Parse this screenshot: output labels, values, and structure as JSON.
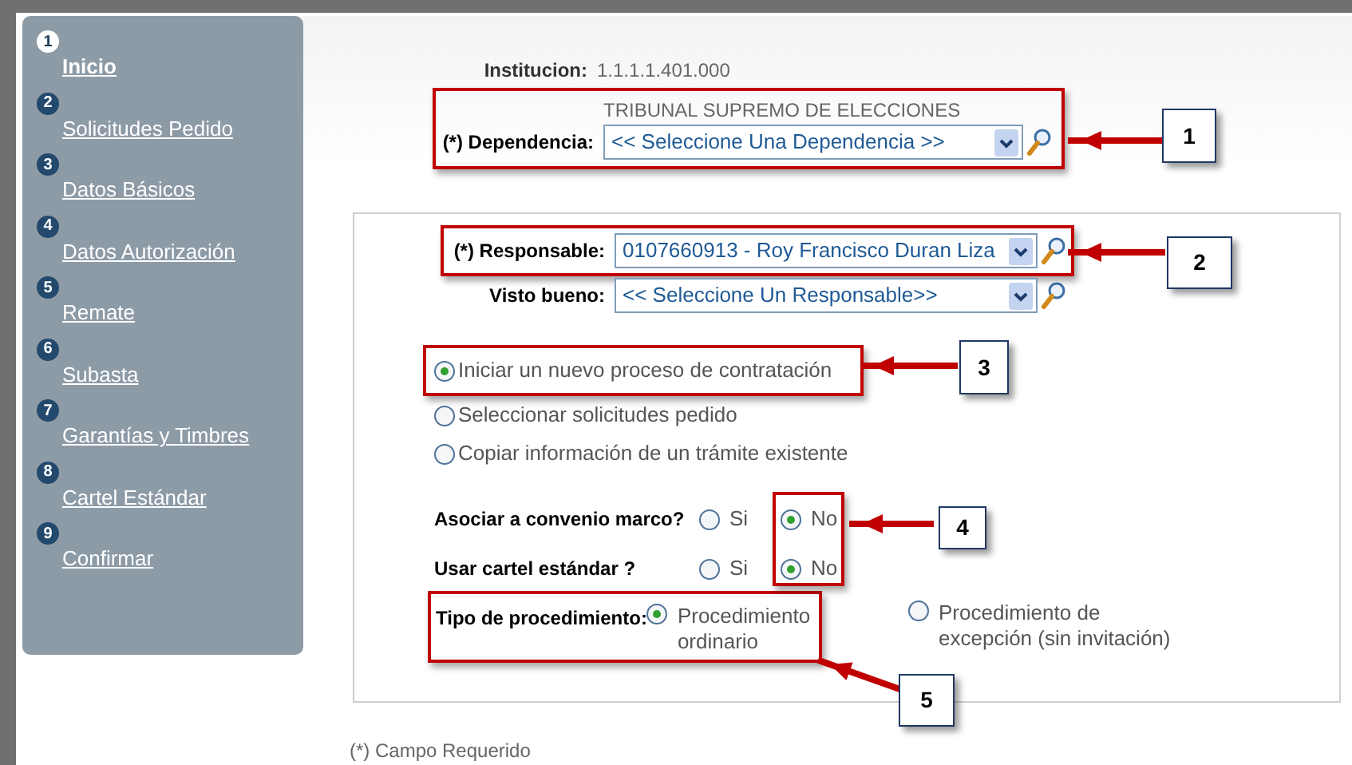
{
  "steps": [
    {
      "number": "1",
      "label": "Inicio",
      "selected": true
    },
    {
      "number": "2",
      "label": "Solicitudes Pedido",
      "selected": false
    },
    {
      "number": "3",
      "label": "Datos Básicos",
      "selected": false
    },
    {
      "number": "4",
      "label": "Datos Autorización",
      "selected": false
    },
    {
      "number": "5",
      "label": "Remate",
      "selected": false
    },
    {
      "number": "6",
      "label": "Subasta",
      "selected": false
    },
    {
      "number": "7",
      "label": "Garantías y Timbres",
      "selected": false
    },
    {
      "number": "8",
      "label": "Cartel Estándar",
      "selected": false
    },
    {
      "number": "9",
      "label": "Confirmar",
      "selected": false
    }
  ],
  "institucion": {
    "label": "Institucion:",
    "value": "1.1.1.1.401.000"
  },
  "dependencia": {
    "caption": "TRIBUNAL SUPREMO DE ELECCIONES",
    "label": "(*) Dependencia:",
    "value": "<< Seleccione Una Dependencia >>"
  },
  "responsable": {
    "label": "(*) Responsable:",
    "value": "0107660913 - Roy Francisco Duran Liza"
  },
  "visto_bueno": {
    "label": "Visto bueno:",
    "value": "<< Seleccione Un Responsable>>"
  },
  "process_options": [
    {
      "label": "Iniciar un nuevo proceso de contratación",
      "selected": true
    },
    {
      "label": "Seleccionar solicitudes pedido",
      "selected": false
    },
    {
      "label": "Copiar información de un trámite existente",
      "selected": false
    }
  ],
  "questions": [
    {
      "label": "Asociar a convenio marco?",
      "options": [
        {
          "label": "Si",
          "selected": false
        },
        {
          "label": "No",
          "selected": true
        }
      ]
    },
    {
      "label": "Usar cartel estándar ?",
      "options": [
        {
          "label": "Si",
          "selected": false
        },
        {
          "label": "No",
          "selected": true
        }
      ]
    }
  ],
  "tipo_procedimiento": {
    "label": "Tipo de procedimiento:",
    "options": [
      {
        "label": "Procedimiento ordinario",
        "selected": true
      },
      {
        "label": "Procedimiento de excepción (sin invitación)",
        "selected": false
      }
    ]
  },
  "footnote": "(*) Campo Requerido",
  "callouts": [
    "1",
    "2",
    "3",
    "4",
    "5"
  ]
}
